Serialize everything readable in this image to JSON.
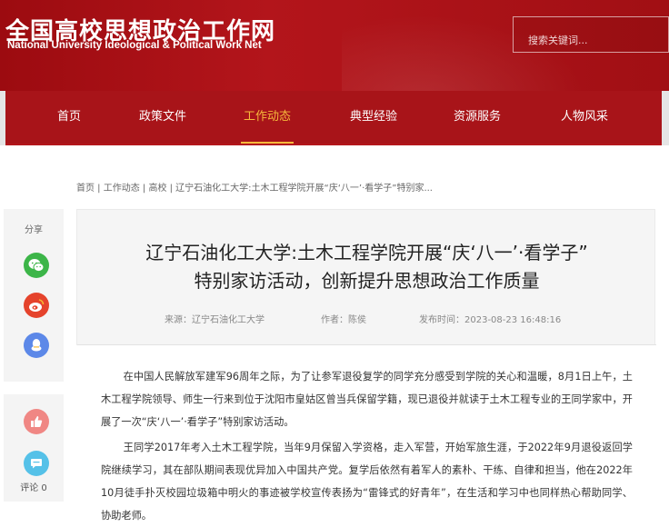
{
  "site": {
    "title_cn": "全国高校思想政治工作网",
    "title_en": "National University Ideological & Political Work Net"
  },
  "search": {
    "placeholder": "搜索关键词..."
  },
  "nav": {
    "items": [
      {
        "label": "首页",
        "active": false
      },
      {
        "label": "政策文件",
        "active": false
      },
      {
        "label": "工作动态",
        "active": true
      },
      {
        "label": "典型经验",
        "active": false
      },
      {
        "label": "资源服务",
        "active": false
      },
      {
        "label": "人物风采",
        "active": false
      }
    ]
  },
  "breadcrumb": "首页 | 工作动态 | 高校 | 辽宁石油化工大学:土木工程学院开展“庆‘八一’·看学子”特别家...",
  "share": {
    "label": "分享",
    "comment_label": "评论 0"
  },
  "article": {
    "title_line1": "辽宁石油化工大学:土木工程学院开展“庆‘八一’·看学子”",
    "title_line2": "特别家访活动，创新提升思想政治工作质量",
    "source": "来源：辽宁石油化工大学",
    "author": "作者：陈侯",
    "published": "发布时间：2023-08-23 16:48:16",
    "paragraphs": [
      "在中国人民解放军建军96周年之际，为了让参军退役复学的同学充分感受到学院的关心和温暖，8月1日上午，土木工程学院领导、师生一行来到位于沈阳市皇姑区曾当兵保留学籍，现已退役并就读于土木工程专业的王同学家中，开展了一次“庆‘八一’·看学子”特别家访活动。",
      "王同学2017年考入土木工程学院，当年9月保留入学资格，走入军营，开始军旅生涯，于2022年9月退役返回学院继续学习，其在部队期间表现优异加入中国共产党。复学后依然有着军人的素朴、干练、自律和担当，他在2022年10月徒手扑灭校园垃圾箱中明火的事迹被学校宣传表扬为“雷锋式的好青年”，在生活和学习中也同样热心帮助同学、协助老师。"
    ]
  },
  "colors": {
    "brand_red": "#a81419",
    "nav_active": "#f6b93b",
    "wechat": "#3cb548",
    "weibo": "#e5432c",
    "qq": "#5c88e8",
    "like": "#f08784",
    "comment": "#55c1e8"
  }
}
